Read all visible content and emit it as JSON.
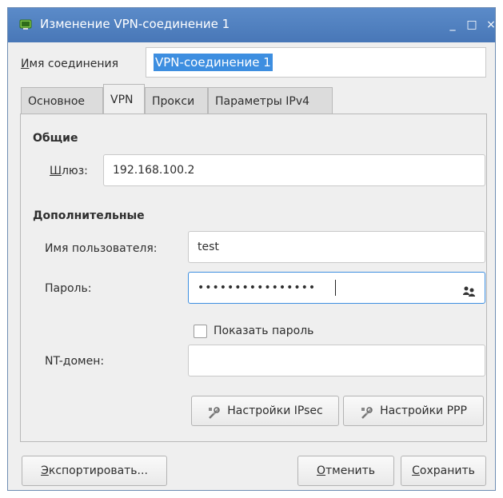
{
  "window": {
    "title": "Изменение VPN-соединение 1",
    "controls": {
      "minimize": "_",
      "maximize": "□",
      "close": "×"
    }
  },
  "connection_name": {
    "label_accel": "И",
    "label_rest": "мя соединения",
    "value": "VPN-соединение 1"
  },
  "tabs": [
    {
      "label": "Основное",
      "active": false
    },
    {
      "label": "VPN",
      "active": true
    },
    {
      "label": "Прокси",
      "active": false
    },
    {
      "label": "Параметры IPv4",
      "active": false
    }
  ],
  "general": {
    "title": "Общие",
    "gateway_label_accel": "Ш",
    "gateway_label_rest": "люз:",
    "gateway_value": "192.168.100.2"
  },
  "advanced": {
    "title": "Дополнительные",
    "username_label": "Имя пользователя:",
    "username_value": "test",
    "password_label": "Пароль:",
    "password_masked": "••••••••••••••••",
    "show_password_label": "Показать пароль",
    "show_password_checked": false,
    "nt_domain_label": "NT-домен:",
    "nt_domain_value": "",
    "ipsec_button": "Настройки IPsec",
    "ppp_button": "Настройки PPP"
  },
  "footer": {
    "export_accel": "Э",
    "export_rest": "кспортировать...",
    "cancel_accel": "О",
    "cancel_rest": "тменить",
    "save_accel": "С",
    "save_rest": "охранить"
  },
  "colors": {
    "titlebar": "#4f7fbf",
    "selection": "#3d8ee0",
    "focus_border": "#3d8ee0"
  },
  "icons": {
    "app": "network-icon",
    "password_menu": "users-icon",
    "settings": "tools-icon"
  }
}
